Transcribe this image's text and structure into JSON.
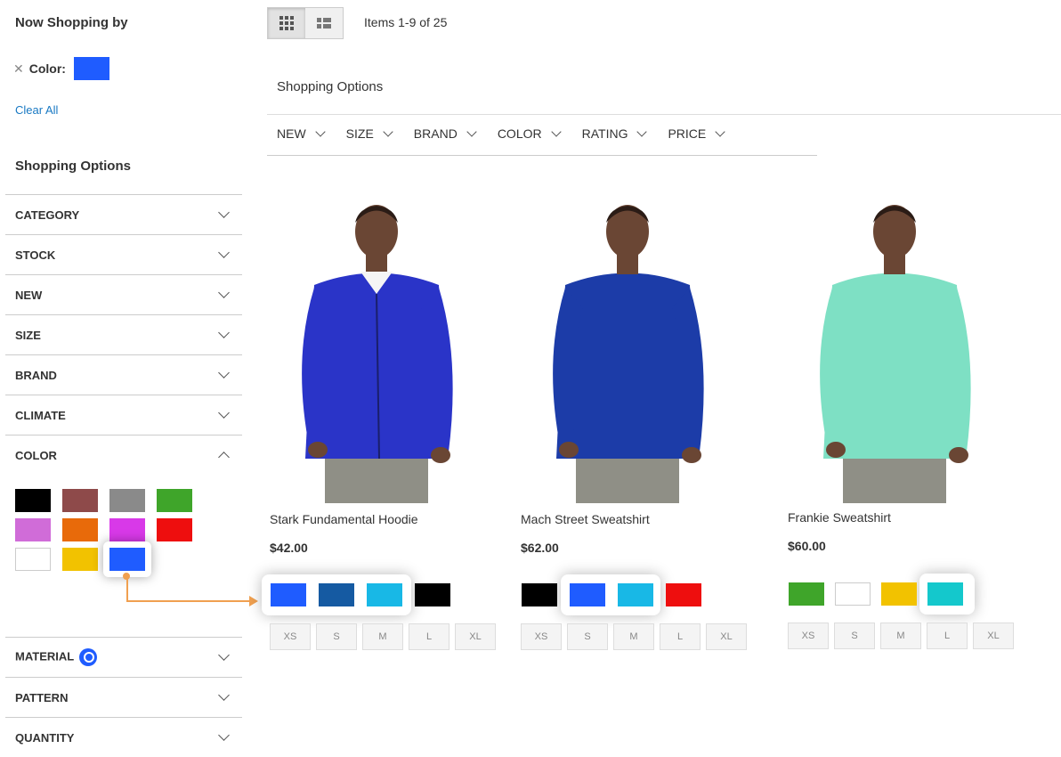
{
  "sidebar": {
    "now_shopping_title": "Now Shopping by",
    "active_filter_label": "Color:",
    "active_filter_color": "#1f5cff",
    "clear_all": "Clear All",
    "shopping_options_title": "Shopping Options",
    "filters_top": [
      "CATEGORY",
      "STOCK",
      "NEW",
      "SIZE",
      "BRAND",
      "CLIMATE",
      "COLOR"
    ],
    "color_swatches": [
      "#000000",
      "#8e4a4a",
      "#8a8a8a",
      "#3fa52a",
      "#d06cd8",
      "#e86a0a",
      "#d839e8",
      "#ee0e0e",
      "#ffffff",
      "#f2c200",
      "#1f5cff"
    ],
    "filters_bottom": [
      "MATERIAL",
      "PATTERN",
      "QUANTITY"
    ]
  },
  "toolbar": {
    "items_count": "Items 1-9 of 25",
    "shopping_options_title": "Shopping Options",
    "top_filters": [
      "NEW",
      "SIZE",
      "BRAND",
      "COLOR",
      "RATING",
      "PRICE"
    ]
  },
  "products": [
    {
      "name": "Stark Fundamental Hoodie",
      "price": "$42.00",
      "shirt_color": "#2a34c8",
      "swatches": [
        "#1f5cff",
        "#155aa2",
        "#18b8e6",
        "#000000"
      ],
      "sizes": [
        "XS",
        "S",
        "M",
        "L",
        "XL"
      ]
    },
    {
      "name": "Mach Street Sweatshirt",
      "price": "$62.00",
      "shirt_color": "#1c3ca8",
      "swatches": [
        "#000000",
        "#1f5cff",
        "#18b8e6",
        "#ee0e0e"
      ],
      "sizes": [
        "XS",
        "S",
        "M",
        "L",
        "XL"
      ]
    },
    {
      "name": "Frankie Sweatshirt",
      "price": "$60.00",
      "shirt_color": "#7ee0c4",
      "swatches": [
        "#3fa52a",
        "#ffffff",
        "#f2c200",
        "#14c8cc"
      ],
      "sizes": [
        "XS",
        "S",
        "M",
        "L",
        "XL"
      ]
    }
  ]
}
